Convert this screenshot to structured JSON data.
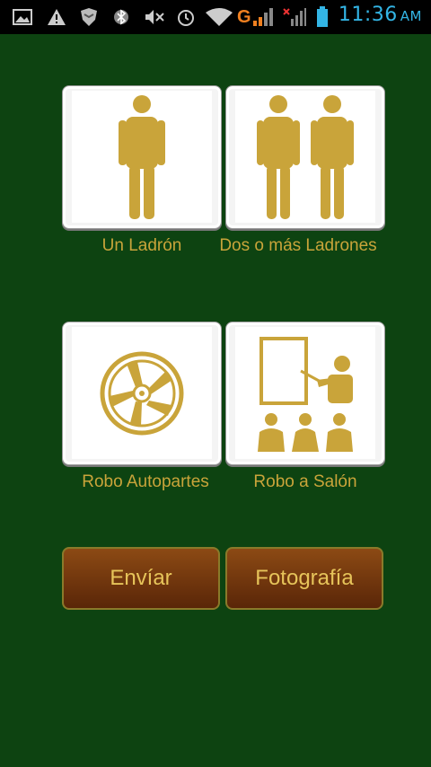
{
  "status_bar": {
    "time": "11:36",
    "ampm": "AM",
    "network_label": "G"
  },
  "tiles": [
    {
      "label": "Un Ladrón",
      "icon": "single-thief-icon"
    },
    {
      "label": "Dos o más Ladrones",
      "icon": "two-thieves-icon"
    },
    {
      "label": "Robo Autopartes",
      "icon": "wheel-rim-icon"
    },
    {
      "label": "Robo a Salón",
      "icon": "classroom-icon"
    }
  ],
  "buttons": {
    "send": "Envíar",
    "photo": "Fotografía"
  },
  "colors": {
    "background": "#0d4311",
    "gold": "#c9a43a",
    "button_brown": "#6e3610",
    "time_blue": "#33b5e5"
  }
}
